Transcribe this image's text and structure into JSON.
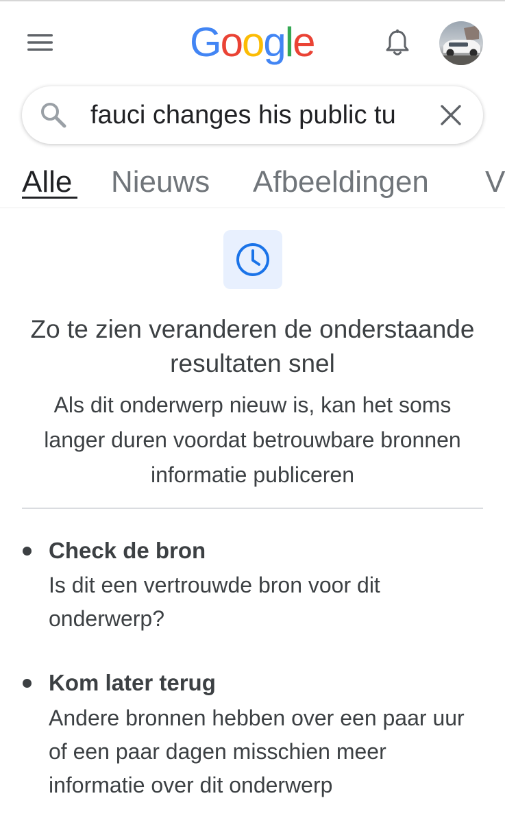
{
  "header": {
    "logo_letters": [
      {
        "char": "G",
        "color": "#4285F4"
      },
      {
        "char": "o",
        "color": "#EA4335"
      },
      {
        "char": "o",
        "color": "#FBBC05"
      },
      {
        "char": "g",
        "color": "#4285F4"
      },
      {
        "char": "l",
        "color": "#34A853"
      },
      {
        "char": "e",
        "color": "#EA4335"
      }
    ],
    "icons": {
      "menu": "hamburger-menu-icon",
      "notifications": "bell-icon",
      "account": "avatar"
    }
  },
  "search": {
    "query": "fauci changes his public tu",
    "icons": {
      "search": "search-icon",
      "clear": "close-icon"
    }
  },
  "tabs": [
    {
      "label": "Alle",
      "active": true
    },
    {
      "label": "Nieuws",
      "active": false
    },
    {
      "label": "Afbeeldingen",
      "active": false
    },
    {
      "label": "V",
      "active": false
    }
  ],
  "notice": {
    "icon": "clock-icon",
    "icon_color": "#1a73e8",
    "headline": "Zo te zien veranderen de onderstaande resultaten snel",
    "subtext": "Als dit onderwerp nieuw is, kan het soms langer duren voordat betrouwbare bronnen informatie publiceren"
  },
  "tips": [
    {
      "title": "Check de bron",
      "body": "Is dit een vertrouwde bron voor dit onderwerp?"
    },
    {
      "title": "Kom later terug",
      "body": "Andere bronnen hebben over een paar uur of een paar dagen misschien meer informatie over dit onderwerp"
    }
  ]
}
